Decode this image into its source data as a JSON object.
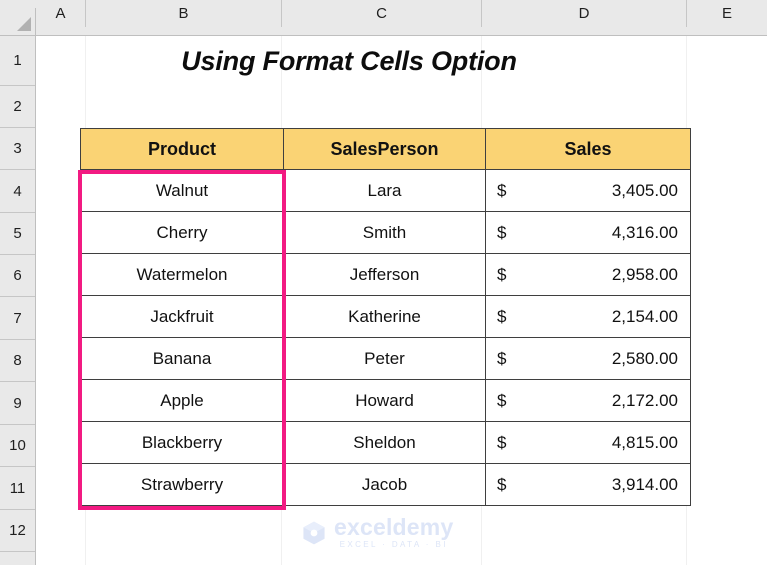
{
  "app": {
    "title": "Using Format Cells Option"
  },
  "grid": {
    "select_all_label": "",
    "column_headers": [
      "A",
      "B",
      "C",
      "D",
      "E"
    ],
    "row_headers": [
      "1",
      "2",
      "3",
      "4",
      "5",
      "6",
      "7",
      "8",
      "9",
      "10",
      "11",
      "12"
    ]
  },
  "table": {
    "headers": [
      "Product",
      "SalesPerson",
      "Sales"
    ],
    "header_fill": "#FAD374",
    "rows": [
      {
        "product": "Walnut",
        "salesperson": "Lara",
        "currency": "$",
        "amount": "3,405.00"
      },
      {
        "product": "Cherry",
        "salesperson": "Smith",
        "currency": "$",
        "amount": "4,316.00"
      },
      {
        "product": "Watermelon",
        "salesperson": "Jefferson",
        "currency": "$",
        "amount": "2,958.00"
      },
      {
        "product": "Jackfruit",
        "salesperson": "Katherine",
        "currency": "$",
        "amount": "2,154.00"
      },
      {
        "product": "Banana",
        "salesperson": "Peter",
        "currency": "$",
        "amount": "2,580.00"
      },
      {
        "product": "Apple",
        "salesperson": "Howard",
        "currency": "$",
        "amount": "2,172.00"
      },
      {
        "product": "Blackberry",
        "salesperson": "Sheldon",
        "currency": "$",
        "amount": "4,815.00"
      },
      {
        "product": "Strawberry",
        "salesperson": "Jacob",
        "currency": "$",
        "amount": "3,914.00"
      }
    ]
  },
  "selection": {
    "highlight_color": "#F21A82",
    "range": "B4:B11"
  },
  "watermark": {
    "name": "exceldemy",
    "tagline": "EXCEL · DATA · BI",
    "color": "#DDE5F7"
  }
}
